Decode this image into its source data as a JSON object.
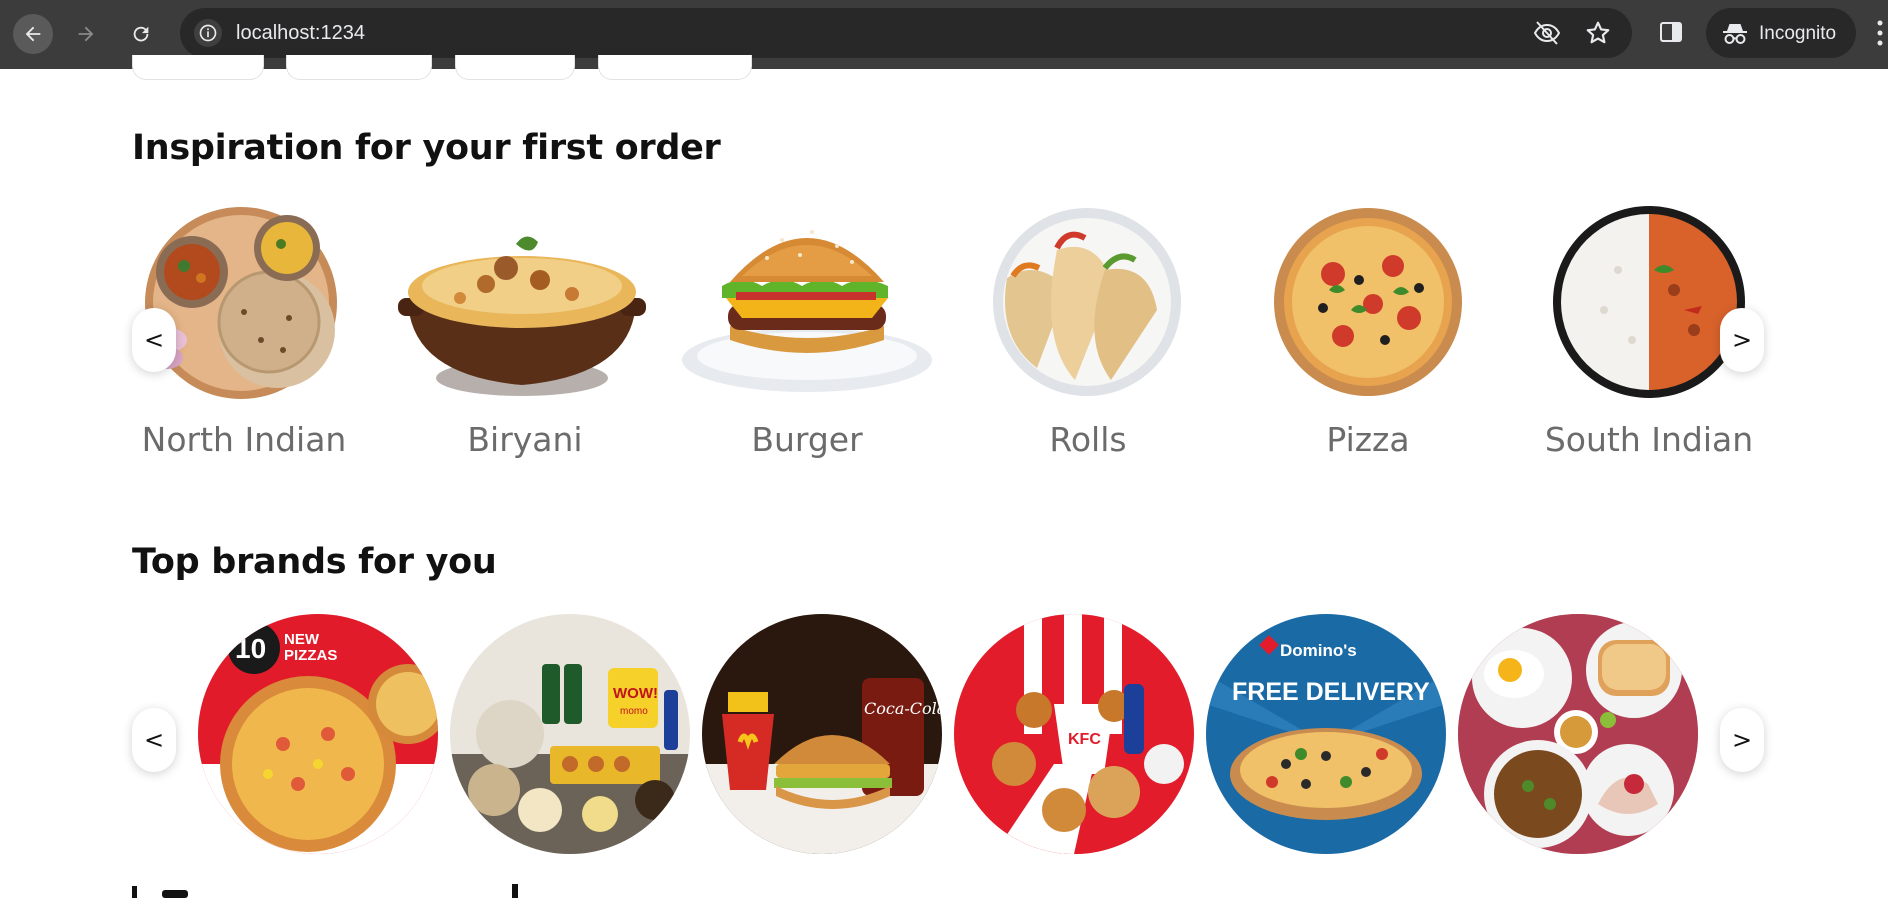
{
  "browser": {
    "url": "localhost:1234",
    "incognito_label": "Incognito"
  },
  "sections": {
    "inspiration_title": "Inspiration for your first order",
    "brands_title": "Top brands for you"
  },
  "cuisines": [
    {
      "label": "North Indian"
    },
    {
      "label": "Biryani"
    },
    {
      "label": "Burger"
    },
    {
      "label": "Rolls"
    },
    {
      "label": "Pizza"
    },
    {
      "label": "South Indian"
    }
  ],
  "carousel": {
    "prev_label": "<",
    "next_label": ">"
  },
  "brands": [
    {
      "name": "pizza-hut",
      "badge_number": "10",
      "badge_line1": "NEW",
      "badge_line2": "PIZZAS"
    },
    {
      "name": "wow-momo",
      "logo_text": "WOW!",
      "logo_sub": "momo"
    },
    {
      "name": "mcdonalds",
      "drink_text": "Coca-Cola"
    },
    {
      "name": "kfc",
      "bucket_text": "KFC"
    },
    {
      "name": "dominos",
      "logo_text": "Domino's",
      "promo_text": "FREE DELIVERY"
    },
    {
      "name": "breakfast"
    }
  ]
}
